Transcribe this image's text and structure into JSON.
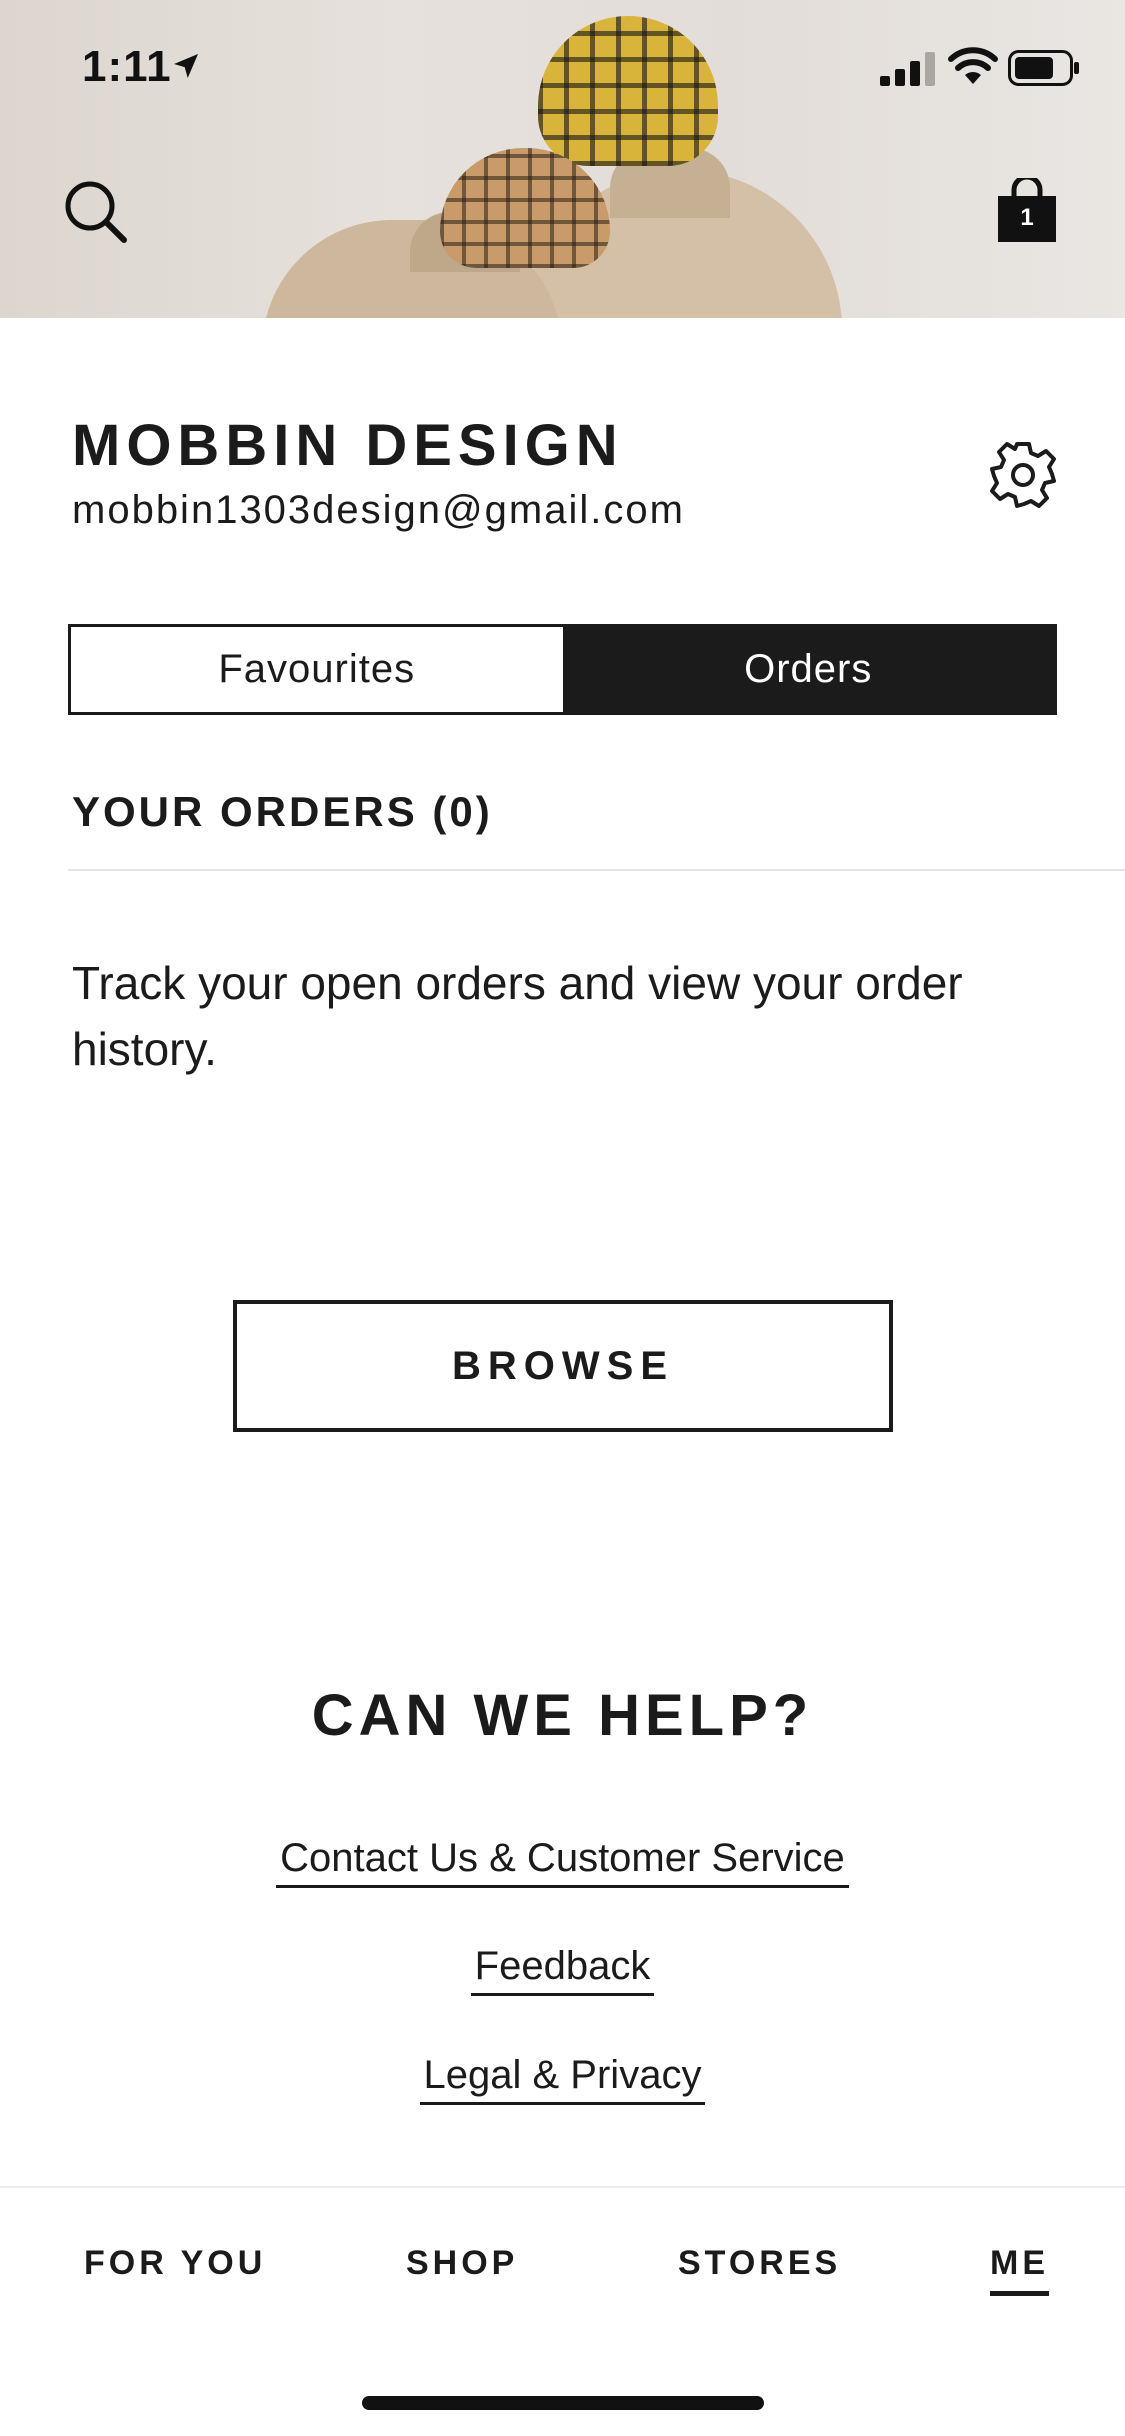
{
  "status_bar": {
    "time": "1:11",
    "icons": [
      "location-arrow-icon",
      "signal-icon",
      "wifi-icon",
      "battery-icon"
    ]
  },
  "header": {
    "search_icon": "search-icon",
    "bag_icon": "shopping-bag-icon",
    "bag_count": "1"
  },
  "profile": {
    "name": "MOBBIN DESIGN",
    "email": "mobbin1303design@gmail.com",
    "settings_icon": "gear-icon"
  },
  "tabs": [
    {
      "label": "Favourites",
      "selected": false
    },
    {
      "label": "Orders",
      "selected": true
    }
  ],
  "orders": {
    "heading": "YOUR ORDERS (0)",
    "description": "Track your open orders and view your order history.",
    "browse_label": "BROWSE"
  },
  "help": {
    "title": "CAN WE HELP?",
    "links": [
      "Contact Us & Customer Service",
      "Feedback",
      "Legal & Privacy"
    ]
  },
  "bottom_nav": {
    "items": [
      "FOR YOU",
      "SHOP",
      "STORES",
      "ME"
    ],
    "active": "ME"
  },
  "colors": {
    "text": "#1b1b1b",
    "background": "#ffffff",
    "selected_tab": "#1b1b1b"
  }
}
